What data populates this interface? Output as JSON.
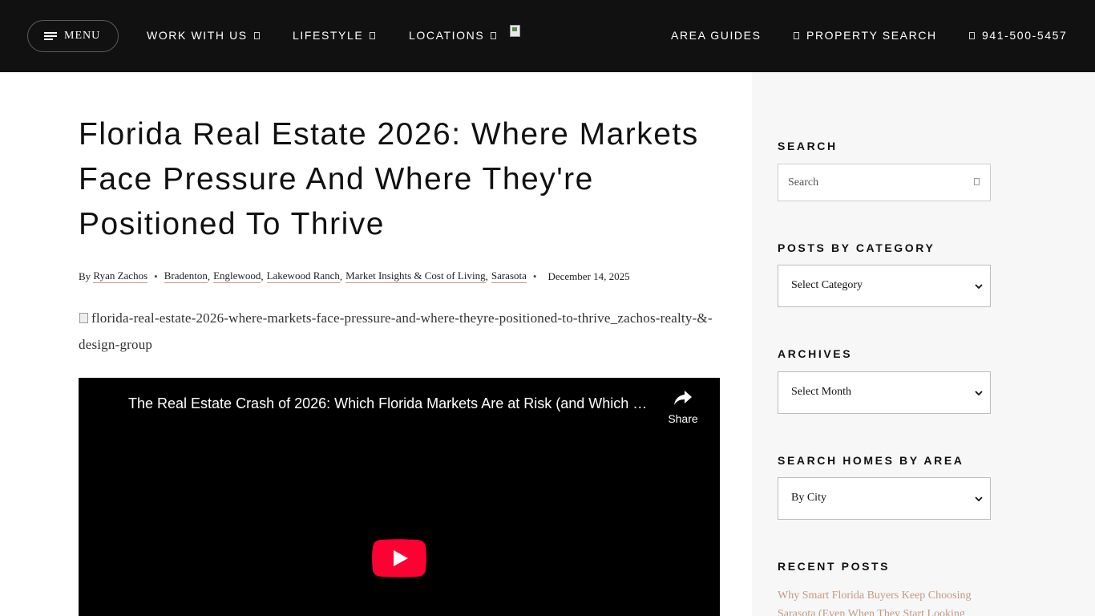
{
  "header": {
    "menu_label": "MENU",
    "nav": {
      "work_with_us": "WORK WITH US",
      "lifestyle": "LIFESTYLE",
      "locations": "LOCATIONS",
      "area_guides": "AREA GUIDES",
      "property_search": "PROPERTY SEARCH",
      "phone": "941-500-5457"
    },
    "colors": {
      "background": "#111111",
      "text": "#ffffff"
    }
  },
  "post": {
    "title": "Florida Real Estate 2026: Where Markets Face Pressure And Where They're Positioned To Thrive",
    "meta": {
      "by_label": "By",
      "author": "Ryan Zachos",
      "categories": [
        "Bradenton",
        "Englewood",
        "Lakewood Ranch",
        "Market Insights & Cost of Living",
        "Sarasota"
      ],
      "date": "December 14, 2025"
    },
    "image_alt": "florida-real-estate-2026-where-markets-face-pressure-and-where-theyre-positioned-to-thrive_zachos-realty-&-design-group",
    "video": {
      "title": "The Real Estate Crash of 2026: Which Florida Markets Are at Risk (and Which …",
      "share_label": "Share"
    }
  },
  "sidebar": {
    "search": {
      "heading": "SEARCH",
      "placeholder": "Search"
    },
    "category": {
      "heading": "POSTS BY CATEGORY",
      "selected": "Select Category"
    },
    "archives": {
      "heading": "ARCHIVES",
      "selected": "Select Month"
    },
    "area": {
      "heading": "SEARCH HOMES BY AREA",
      "selected": "By City"
    },
    "recent": {
      "heading": "RECENT POSTS",
      "first_post": "Why Smart Florida Buyers Keep Choosing Sarasota (Even When They Start Looking"
    },
    "colors": {
      "background": "#f7f7f7",
      "link": "#c49a80"
    }
  },
  "icons": [
    "hamburger-icon",
    "dropdown-caret-icon",
    "search-icon",
    "phone-icon",
    "broken-image-icon",
    "share-icon",
    "youtube-play-icon",
    "chevron-down-icon"
  ]
}
